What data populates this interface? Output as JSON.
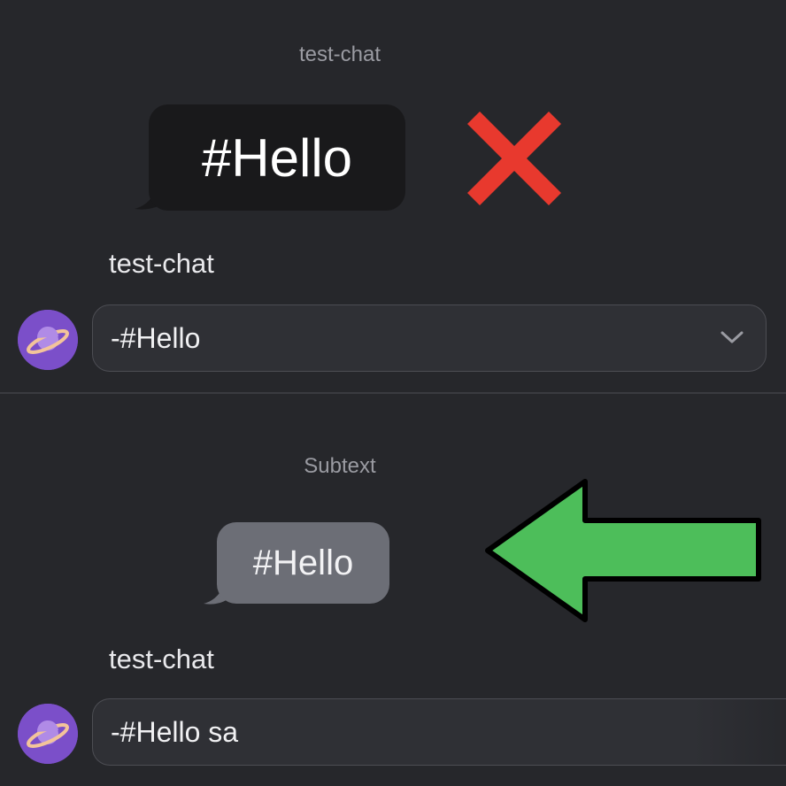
{
  "top": {
    "preview_label": "test-chat",
    "bubble_text": "#Hello",
    "status_icon": "red-x-icon",
    "field_label": "test-chat",
    "input_value": "-#Hello",
    "dropdown_icon": "chevron-down-icon",
    "avatar_icon": "planet-icon"
  },
  "bottom": {
    "preview_label": "Subtext",
    "bubble_text": "#Hello",
    "status_icon": "green-arrow-left-icon",
    "field_label": "test-chat",
    "input_value": "-#Hello sa",
    "avatar_icon": "planet-icon"
  },
  "colors": {
    "background": "#26272b",
    "dark_bubble": "#19191b",
    "grey_bubble": "#6c6e76",
    "red_x": "#e8392e",
    "green_arrow": "#4dbe5a",
    "avatar": "#7b4fc9"
  }
}
